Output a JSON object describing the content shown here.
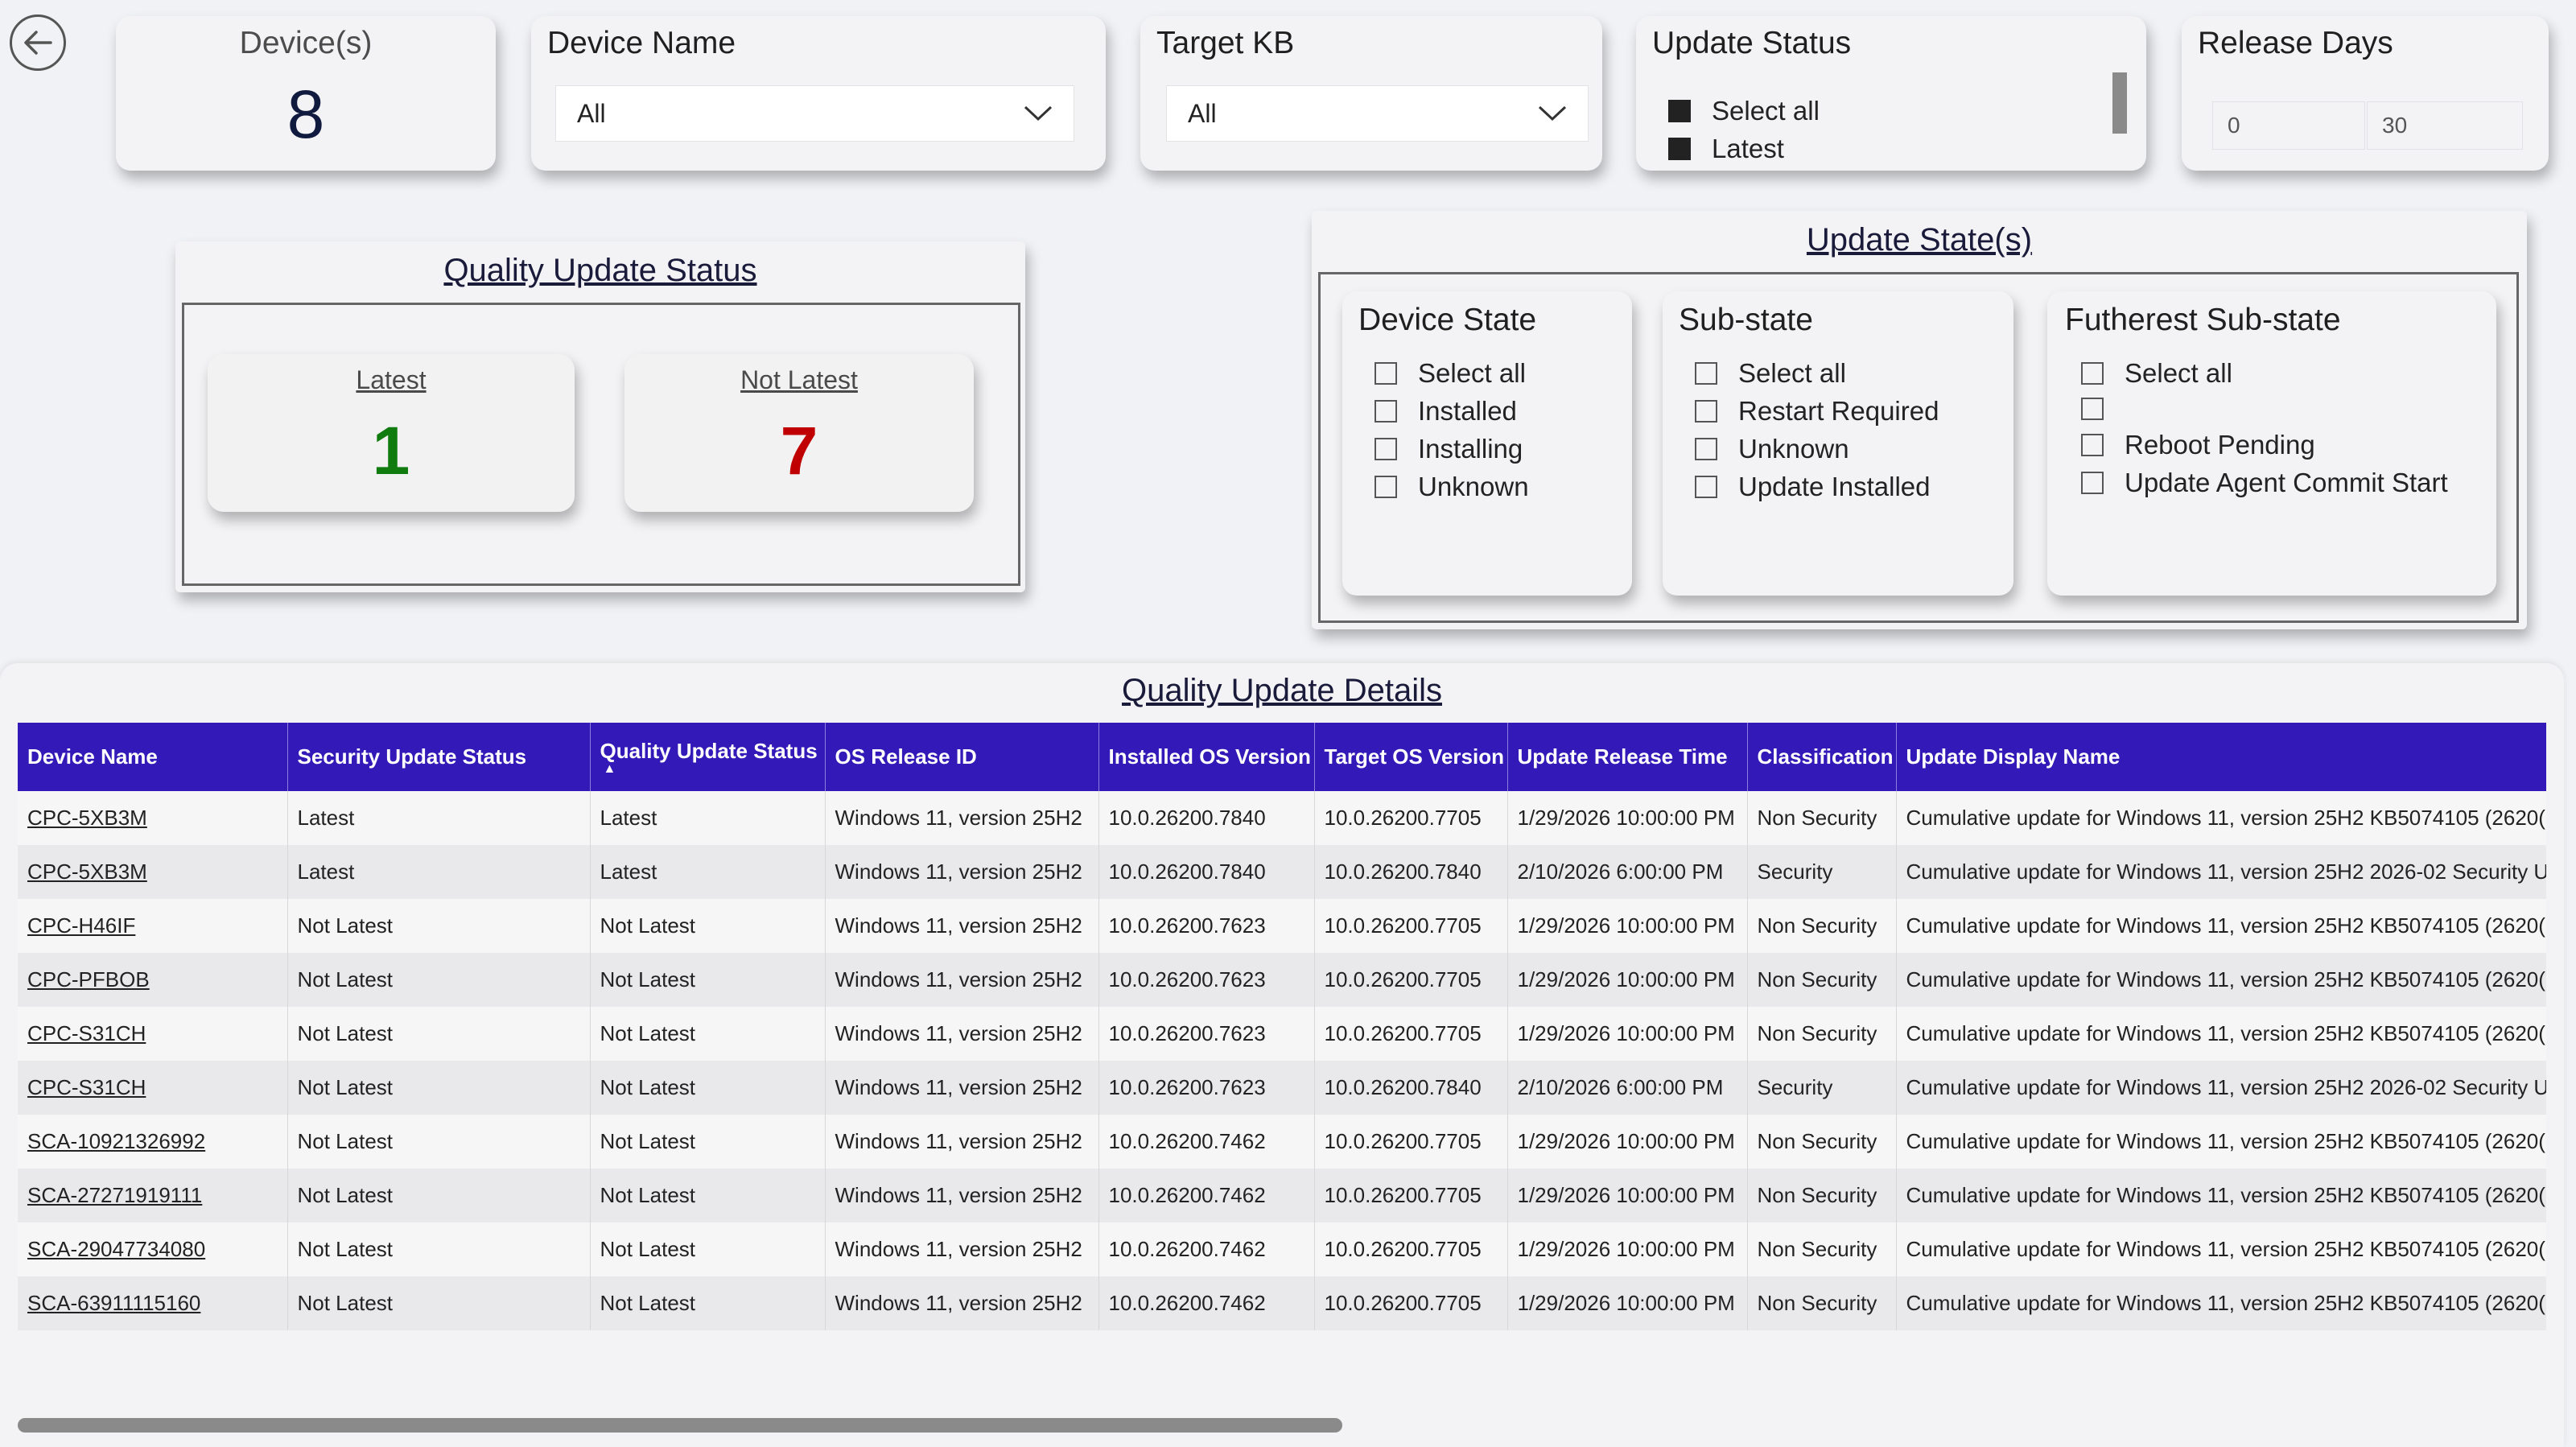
{
  "nav": {
    "back_label": "Back"
  },
  "kpi_devices": {
    "label": "Device(s)",
    "value": "8"
  },
  "filters": {
    "device_name": {
      "title": "Device Name",
      "value": "All"
    },
    "target_kb": {
      "title": "Target KB",
      "value": "All"
    },
    "update_status": {
      "title": "Update Status",
      "items": [
        "Select all",
        "Latest"
      ]
    },
    "release_days": {
      "title": "Release Days",
      "min": "0",
      "max": "30"
    }
  },
  "quality_status": {
    "title": "Quality Update Status",
    "latest": {
      "label": "Latest",
      "value": "1",
      "color": "#107c10"
    },
    "not_latest": {
      "label": "Not Latest",
      "value": "7",
      "color": "#c00000"
    }
  },
  "update_states": {
    "title": "Update State(s)",
    "device_state": {
      "title": "Device State",
      "items": [
        "Select all",
        "Installed",
        "Installing",
        "Unknown"
      ]
    },
    "sub_state": {
      "title": "Sub-state",
      "items": [
        "Select all",
        "Restart Required",
        "Unknown",
        "Update Installed"
      ]
    },
    "furthest_sub_state": {
      "title": "Futherest Sub-state",
      "items": [
        "Select all",
        "",
        "Reboot Pending",
        "Update Agent Commit Start"
      ]
    }
  },
  "details": {
    "title": "Quality Update Details",
    "header_color": "#3219b8",
    "columns": [
      "Device Name",
      "Security Update Status",
      "Quality Update Status",
      "OS Release ID",
      "Installed OS Version",
      "Target OS Version",
      "Update Release Time",
      "Classification",
      "Update Display Name"
    ],
    "rows": [
      [
        "CPC-5XB3M",
        "Latest",
        "Latest",
        "Windows 11, version 25H2",
        "10.0.26200.7840",
        "10.0.26200.7705",
        "1/29/2026 10:00:00 PM",
        "Non Security",
        "Cumulative update for Windows 11, version 25H2 KB5074105 (2620("
      ],
      [
        "CPC-5XB3M",
        "Latest",
        "Latest",
        "Windows 11, version 25H2",
        "10.0.26200.7840",
        "10.0.26200.7840",
        "2/10/2026 6:00:00 PM",
        "Security",
        "Cumulative update for Windows 11, version 25H2 2026-02 Security U"
      ],
      [
        "CPC-H46IF",
        "Not Latest",
        "Not Latest",
        "Windows 11, version 25H2",
        "10.0.26200.7623",
        "10.0.26200.7705",
        "1/29/2026 10:00:00 PM",
        "Non Security",
        "Cumulative update for Windows 11, version 25H2 KB5074105 (2620("
      ],
      [
        "CPC-PFBOB",
        "Not Latest",
        "Not Latest",
        "Windows 11, version 25H2",
        "10.0.26200.7623",
        "10.0.26200.7705",
        "1/29/2026 10:00:00 PM",
        "Non Security",
        "Cumulative update for Windows 11, version 25H2 KB5074105 (2620("
      ],
      [
        "CPC-S31CH",
        "Not Latest",
        "Not Latest",
        "Windows 11, version 25H2",
        "10.0.26200.7623",
        "10.0.26200.7705",
        "1/29/2026 10:00:00 PM",
        "Non Security",
        "Cumulative update for Windows 11, version 25H2 KB5074105 (2620("
      ],
      [
        "CPC-S31CH",
        "Not Latest",
        "Not Latest",
        "Windows 11, version 25H2",
        "10.0.26200.7623",
        "10.0.26200.7840",
        "2/10/2026 6:00:00 PM",
        "Security",
        "Cumulative update for Windows 11, version 25H2 2026-02 Security U"
      ],
      [
        "SCA-10921326992",
        "Not Latest",
        "Not Latest",
        "Windows 11, version 25H2",
        "10.0.26200.7462",
        "10.0.26200.7705",
        "1/29/2026 10:00:00 PM",
        "Non Security",
        "Cumulative update for Windows 11, version 25H2 KB5074105 (2620("
      ],
      [
        "SCA-27271919111",
        "Not Latest",
        "Not Latest",
        "Windows 11, version 25H2",
        "10.0.26200.7462",
        "10.0.26200.7705",
        "1/29/2026 10:00:00 PM",
        "Non Security",
        "Cumulative update for Windows 11, version 25H2 KB5074105 (2620("
      ],
      [
        "SCA-29047734080",
        "Not Latest",
        "Not Latest",
        "Windows 11, version 25H2",
        "10.0.26200.7462",
        "10.0.26200.7705",
        "1/29/2026 10:00:00 PM",
        "Non Security",
        "Cumulative update for Windows 11, version 25H2 KB5074105 (2620("
      ],
      [
        "SCA-63911115160",
        "Not Latest",
        "Not Latest",
        "Windows 11, version 25H2",
        "10.0.26200.7462",
        "10.0.26200.7705",
        "1/29/2026 10:00:00 PM",
        "Non Security",
        "Cumulative update for Windows 11, version 25H2 KB5074105 (2620("
      ]
    ]
  }
}
